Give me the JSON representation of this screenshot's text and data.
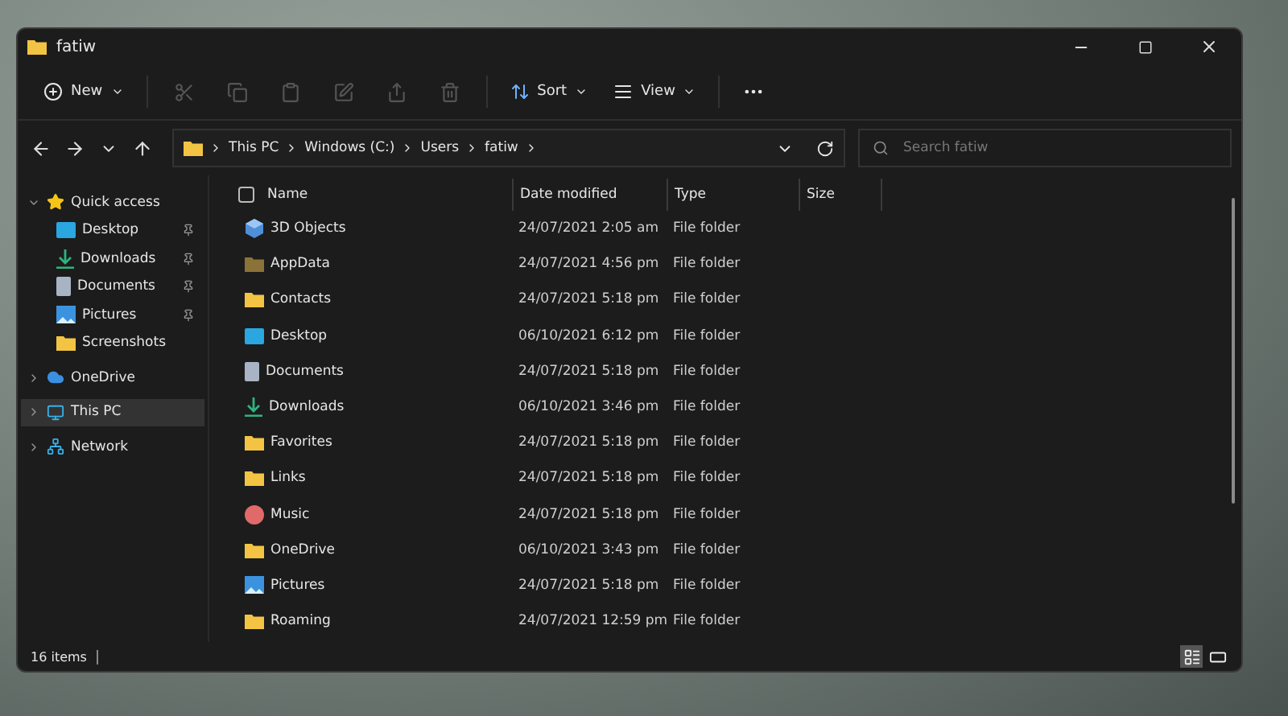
{
  "window": {
    "title": "fatiw"
  },
  "toolbar": {
    "new": "New",
    "sort": "Sort",
    "view": "View"
  },
  "address": {
    "path": [
      "This PC",
      "Windows (C:)",
      "Users",
      "fatiw"
    ],
    "search_placeholder": "Search fatiw"
  },
  "sidebar": {
    "items": [
      {
        "label": "Quick access",
        "kind": "star",
        "expanded": true,
        "selected": false,
        "children": [
          {
            "label": "Desktop",
            "kind": "desktop",
            "pinned": true
          },
          {
            "label": "Downloads",
            "kind": "downloads",
            "pinned": true
          },
          {
            "label": "Documents",
            "kind": "documents",
            "pinned": true
          },
          {
            "label": "Pictures",
            "kind": "pictures",
            "pinned": true
          },
          {
            "label": "Screenshots",
            "kind": "folder",
            "pinned": false
          }
        ]
      },
      {
        "label": "OneDrive",
        "kind": "cloud",
        "expanded": false,
        "selected": false
      },
      {
        "label": "This PC",
        "kind": "pc",
        "expanded": false,
        "selected": true
      },
      {
        "label": "Network",
        "kind": "network",
        "expanded": false,
        "selected": false
      }
    ]
  },
  "table": {
    "select_all_checked": false,
    "columns": [
      "Name",
      "Date modified",
      "Type",
      "Size"
    ],
    "rows": [
      {
        "name": "3D Objects",
        "date": "24/07/2021 2:05 am",
        "type": "File folder",
        "kind": "cube"
      },
      {
        "name": "AppData",
        "date": "24/07/2021 4:56 pm",
        "type": "File folder",
        "kind": "hidden"
      },
      {
        "name": "Contacts",
        "date": "24/07/2021 5:18 pm",
        "type": "File folder",
        "kind": "folder"
      },
      {
        "name": "Desktop",
        "date": "06/10/2021 6:12 pm",
        "type": "File folder",
        "kind": "desktop"
      },
      {
        "name": "Documents",
        "date": "24/07/2021 5:18 pm",
        "type": "File folder",
        "kind": "documents"
      },
      {
        "name": "Downloads",
        "date": "06/10/2021 3:46 pm",
        "type": "File folder",
        "kind": "downloads"
      },
      {
        "name": "Favorites",
        "date": "24/07/2021 5:18 pm",
        "type": "File folder",
        "kind": "folder"
      },
      {
        "name": "Links",
        "date": "24/07/2021 5:18 pm",
        "type": "File folder",
        "kind": "folder"
      },
      {
        "name": "Music",
        "date": "24/07/2021 5:18 pm",
        "type": "File folder",
        "kind": "music"
      },
      {
        "name": "OneDrive",
        "date": "06/10/2021 3:43 pm",
        "type": "File folder",
        "kind": "folder"
      },
      {
        "name": "Pictures",
        "date": "24/07/2021 5:18 pm",
        "type": "File folder",
        "kind": "pictures"
      },
      {
        "name": "Roaming",
        "date": "24/07/2021 12:59 pm",
        "type": "File folder",
        "kind": "folder"
      }
    ]
  },
  "status_bar": {
    "count": "16 items",
    "views": [
      {
        "kind": "details",
        "selected": true
      },
      {
        "kind": "tiles",
        "selected": false
      }
    ]
  }
}
